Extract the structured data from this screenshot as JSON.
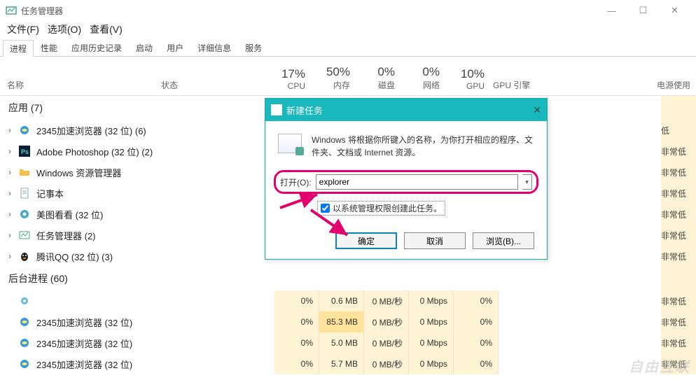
{
  "window": {
    "title": "任务管理器"
  },
  "menu": {
    "file": "文件(F)",
    "options": "选项(O)",
    "view": "查看(V)"
  },
  "tabs": [
    "进程",
    "性能",
    "应用历史记录",
    "启动",
    "用户",
    "详细信息",
    "服务"
  ],
  "headers": {
    "name": "名称",
    "status": "状态",
    "metrics": [
      {
        "pct": "17%",
        "label": "CPU"
      },
      {
        "pct": "50%",
        "label": "内存"
      },
      {
        "pct": "0%",
        "label": "磁盘"
      },
      {
        "pct": "0%",
        "label": "网络"
      },
      {
        "pct": "10%",
        "label": "GPU"
      }
    ],
    "gpu_engine": "GPU 引擎",
    "power": "电源使用"
  },
  "groups": {
    "apps": {
      "title": "应用 (7)",
      "rows": [
        {
          "name": "2345加速浏览器 (32 位) (6)",
          "power": "低"
        },
        {
          "name": "Adobe Photoshop (32 位) (2)",
          "power": "非常低"
        },
        {
          "name": "Windows 资源管理器",
          "power": "非常低"
        },
        {
          "name": "记事本",
          "power": "非常低"
        },
        {
          "name": "美图看看 (32 位)",
          "power": "非常低"
        },
        {
          "name": "任务管理器 (2)",
          "power": "非常低"
        },
        {
          "name": "腾讯QQ (32 位) (3)",
          "power": "非常低"
        }
      ]
    },
    "background": {
      "title": "后台进程 (60)",
      "rows": [
        {
          "name": "",
          "cpu": "0%",
          "mem": "0.6 MB",
          "disk": "0 MB/秒",
          "net": "0 Mbps",
          "gpu": "0%",
          "power": "非常低"
        },
        {
          "name": "2345加速浏览器 (32 位)",
          "cpu": "0%",
          "mem": "85.3 MB",
          "disk": "0 MB/秒",
          "net": "0 Mbps",
          "gpu": "0%",
          "power": "非常低"
        },
        {
          "name": "2345加速浏览器 (32 位)",
          "cpu": "0%",
          "mem": "5.0 MB",
          "disk": "0 MB/秒",
          "net": "0 Mbps",
          "gpu": "0%",
          "power": "非常低"
        },
        {
          "name": "2345加速浏览器 (32 位)",
          "cpu": "0%",
          "mem": "5.7 MB",
          "disk": "0 MB/秒",
          "net": "0 Mbps",
          "gpu": "0%",
          "power": "非常低"
        }
      ]
    }
  },
  "dialog": {
    "title": "新建任务",
    "desc": "Windows 将根据你所键入的名称，为你打开相应的程序、文件夹、文档或 Internet 资源。",
    "open_label": "打开(O):",
    "input_value": "explorer",
    "checkbox": "以系统管理权限创建此任务。",
    "ok": "确定",
    "cancel": "取消",
    "browse": "浏览(B)..."
  },
  "watermark": "自由互联"
}
